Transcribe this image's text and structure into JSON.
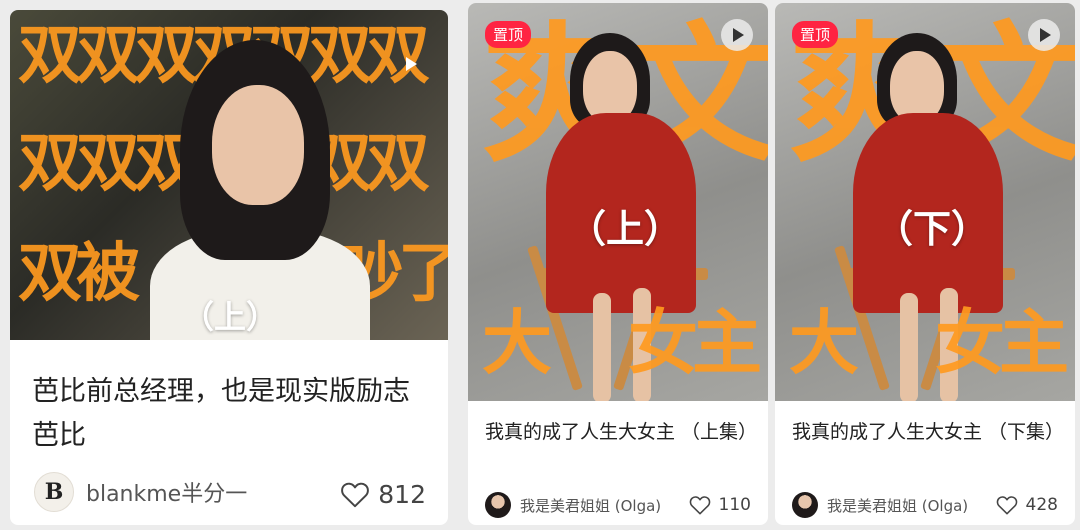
{
  "cards": [
    {
      "title": "芭比前总经理，也是现实版励志芭比",
      "author": "blankme半分一",
      "avatar_letter": "B",
      "likes": "812",
      "cover_overlay": {
        "rows": [
          "双双双双双双双",
          "双双双双双双双",
          "双被"
        ],
        "right_text": "吵了",
        "part": "（上）"
      },
      "play_icon": "play-icon"
    },
    {
      "pin": "置顶",
      "title": "我真的成了人生大女主 （上集）",
      "author": "我是美君姐姐 (Olga)",
      "likes": "110",
      "cover_overlay": {
        "top": "爽文",
        "part": "（上）",
        "bottom_left": "大",
        "bottom_right": "女主"
      },
      "play_icon": "play-icon"
    },
    {
      "pin": "置顶",
      "title": "我真的成了人生大女主 （下集）",
      "author": "我是美君姐姐 (Olga)",
      "likes": "428",
      "cover_overlay": {
        "top": "爽文",
        "part": "（下）",
        "bottom_left": "大",
        "bottom_right": "女主"
      },
      "play_icon": "play-icon"
    }
  ],
  "colors": {
    "overlay_orange": "#ff9a1f",
    "pin_red": "#ff2442",
    "coat_red": "#b3261e"
  },
  "icons": [
    "play-icon",
    "heart-icon",
    "avatar"
  ]
}
